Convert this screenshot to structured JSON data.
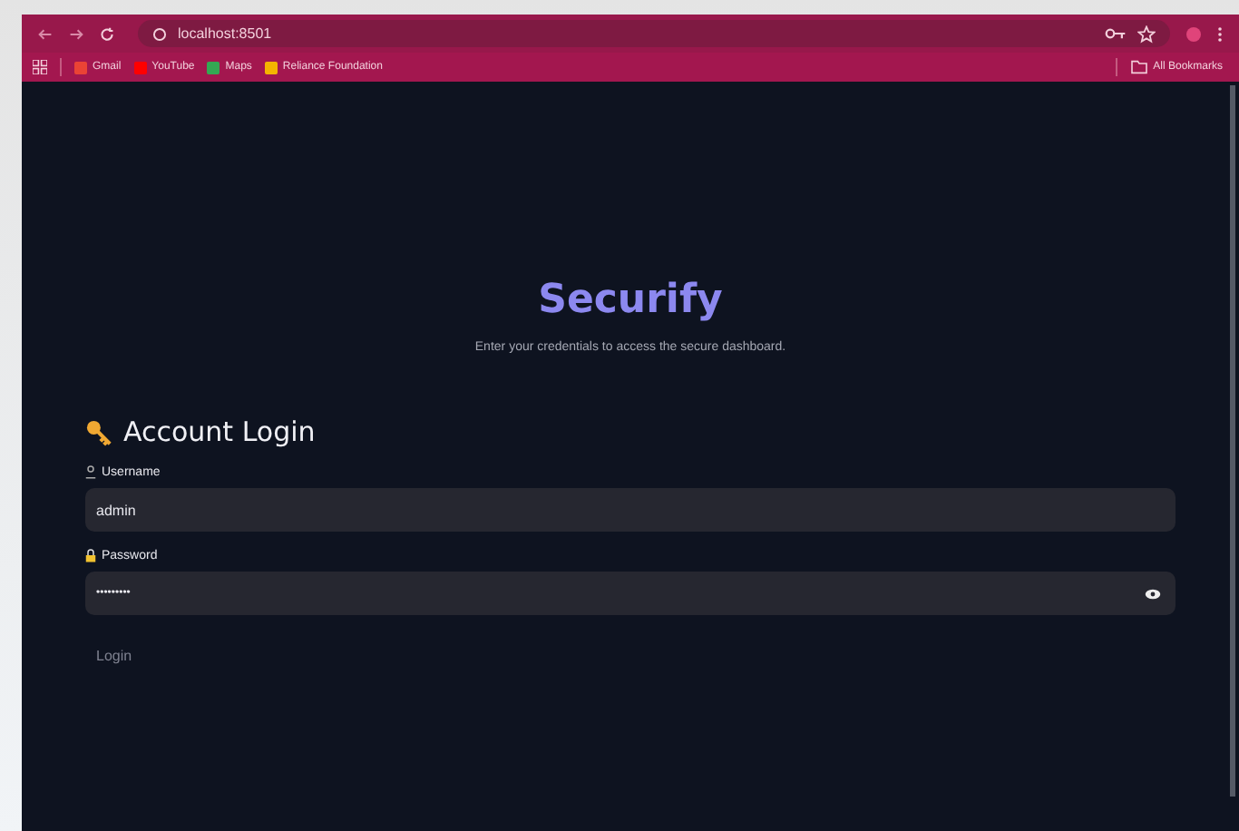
{
  "browser": {
    "url": "localhost:8501",
    "bookmarks": [
      {
        "label": "Gmail",
        "color": "#ea4335"
      },
      {
        "label": "YouTube",
        "color": "#ff0000"
      },
      {
        "label": "Maps",
        "color": "#34a853"
      },
      {
        "label": "Reliance Foundation",
        "color": "#f4b400"
      }
    ],
    "all_bookmarks": "All Bookmarks"
  },
  "app": {
    "title": "Securify",
    "subtitle": "Enter your credentials to access the secure dashboard.",
    "section_title": "Account Login",
    "fields": [
      {
        "kind": "text",
        "label": "Username",
        "value": "admin"
      },
      {
        "kind": "password",
        "label": "Password",
        "value": "•••••••••"
      }
    ],
    "button": "Login"
  }
}
